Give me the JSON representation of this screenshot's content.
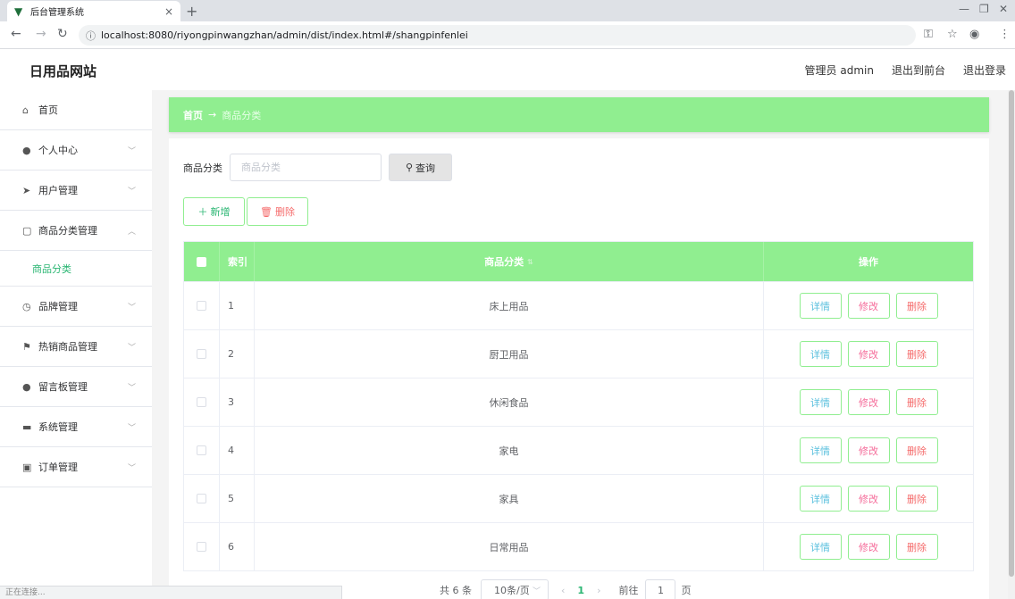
{
  "browser": {
    "tab_title": "后台管理系统",
    "tab_close": "×",
    "new_tab": "+",
    "url": "localhost:8080/riyongpinwangzhan/admin/dist/index.html#/shangpinfenlei",
    "status": "正在连接..."
  },
  "header": {
    "brand": "日用品网站",
    "user": "管理员 admin",
    "front_link": "退出到前台",
    "logout": "退出登录"
  },
  "sidebar": {
    "items": [
      {
        "label": "首页",
        "icon": "home-icon"
      },
      {
        "label": "个人中心",
        "icon": "user-icon"
      },
      {
        "label": "用户管理",
        "icon": "send-icon"
      },
      {
        "label": "商品分类管理",
        "icon": "copy-icon"
      },
      {
        "label": "品牌管理",
        "icon": "clock-icon"
      },
      {
        "label": "热销商品管理",
        "icon": "flag-icon"
      },
      {
        "label": "留言板管理",
        "icon": "location-icon"
      },
      {
        "label": "系统管理",
        "icon": "briefcase-icon"
      },
      {
        "label": "订单管理",
        "icon": "clipboard-icon"
      }
    ],
    "sub_active": "商品分类"
  },
  "breadcrumb": {
    "home": "首页",
    "separator": "→",
    "current": "商品分类"
  },
  "search": {
    "label": "商品分类",
    "placeholder": "商品分类",
    "button": "查询"
  },
  "actions": {
    "add": "新增",
    "delete": "删除"
  },
  "table": {
    "headers": {
      "index": "索引",
      "name": "商品分类",
      "ops": "操作"
    },
    "rows": [
      {
        "index": "1",
        "name": "床上用品"
      },
      {
        "index": "2",
        "name": "厨卫用品"
      },
      {
        "index": "3",
        "name": "休闲食品"
      },
      {
        "index": "4",
        "name": "家电"
      },
      {
        "index": "5",
        "name": "家具"
      },
      {
        "index": "6",
        "name": "日常用品"
      }
    ],
    "ops": {
      "detail": "详情",
      "edit": "修改",
      "delete": "删除"
    }
  },
  "pagination": {
    "total": "共 6 条",
    "page_size": "10条/页",
    "current": "1",
    "goto_prefix": "前往",
    "goto_value": "1",
    "goto_suffix": "页"
  },
  "colors": {
    "accent_green": "#90ee90",
    "text_green": "#2bb673",
    "danger": "#f56c6c"
  }
}
